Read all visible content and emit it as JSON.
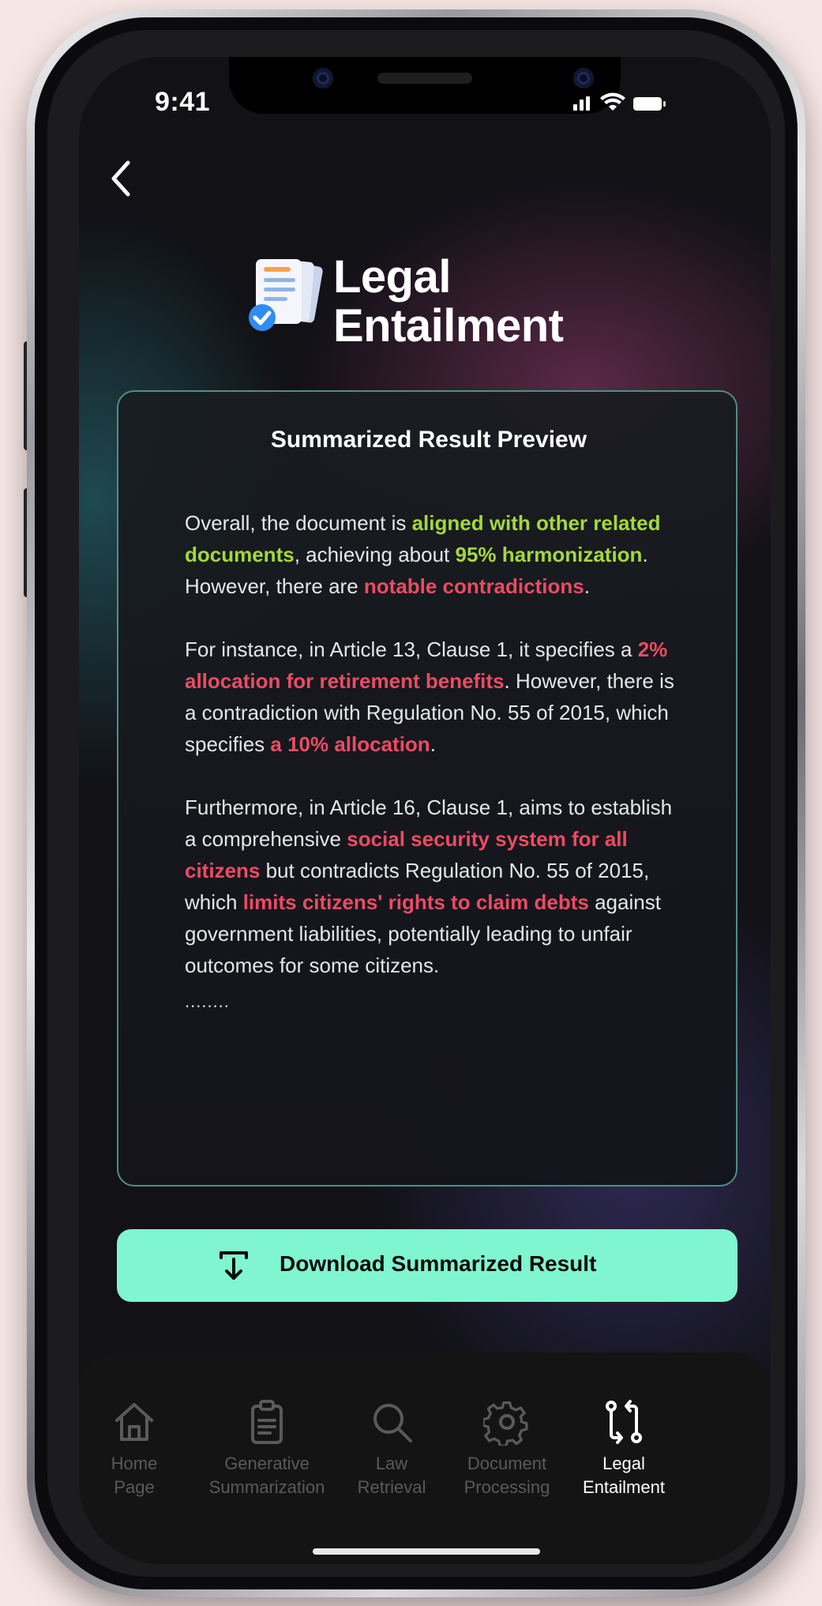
{
  "status_bar": {
    "time": "9:41"
  },
  "header": {
    "title_line1": "Legal",
    "title_line2": "Entailment"
  },
  "card": {
    "title": "Summarized Result Preview",
    "paragraphs": [
      [
        {
          "t": "Overall, the document is ",
          "s": ""
        },
        {
          "t": "aligned with other related documents",
          "s": "g"
        },
        {
          "t": ", achieving about ",
          "s": ""
        },
        {
          "t": "95% harmonization",
          "s": "g"
        },
        {
          "t": ". However, there are ",
          "s": ""
        },
        {
          "t": "notable contradictions",
          "s": "r"
        },
        {
          "t": ".",
          "s": ""
        }
      ],
      [
        {
          "t": "For instance, in Article 13, Clause 1, it specifies a ",
          "s": ""
        },
        {
          "t": "2% allocation for retirement benefits",
          "s": "r"
        },
        {
          "t": ". However, there is a contradiction with Regulation No. 55 of 2015, which specifies ",
          "s": ""
        },
        {
          "t": "a 10% allocation",
          "s": "r"
        },
        {
          "t": ".",
          "s": ""
        }
      ],
      [
        {
          "t": "Furthermore, in Article 16, Clause 1, aims to establish a comprehensive ",
          "s": ""
        },
        {
          "t": "social security system for all citizens",
          "s": "r"
        },
        {
          "t": " but contradicts Regulation No. 55 of 2015, which ",
          "s": ""
        },
        {
          "t": "limits citizens' rights to claim debts",
          "s": "r"
        },
        {
          "t": " against government liabilities, potentially leading to unfair outcomes for some citizens.",
          "s": ""
        }
      ]
    ],
    "ellipsis": "........"
  },
  "download_button": {
    "label": "Download Summarized Result",
    "icon": "download-icon"
  },
  "tabbar": {
    "items": [
      {
        "line1": "Home",
        "line2": "Page",
        "icon": "home-icon",
        "active": false
      },
      {
        "line1": "Generative",
        "line2": "Summarization",
        "icon": "clipboard-icon",
        "active": false
      },
      {
        "line1": "Law",
        "line2": "Retrieval",
        "icon": "search-icon",
        "active": false
      },
      {
        "line1": "Document",
        "line2": "Processing",
        "icon": "gear-icon",
        "active": false
      },
      {
        "line1": "Legal",
        "line2": "Entailment",
        "icon": "git-compare-icon",
        "active": true
      }
    ]
  },
  "colors": {
    "accent": "#7ff6cf",
    "highlight_green": "#a4d83c",
    "highlight_red": "#ec4b64",
    "card_border": "#4e8f86"
  }
}
